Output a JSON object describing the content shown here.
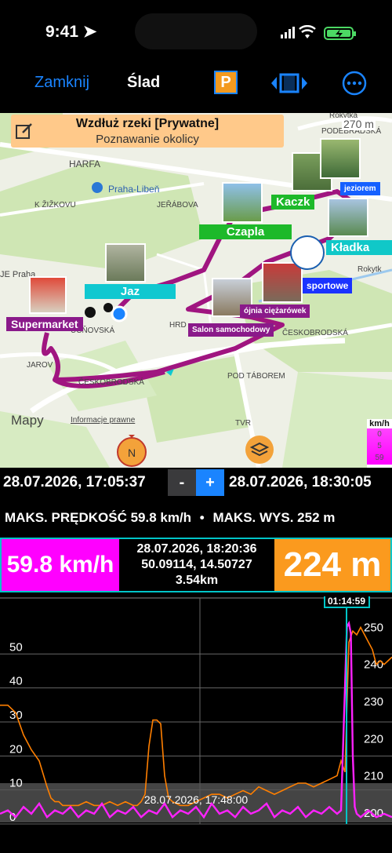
{
  "status_bar": {
    "time": "9:41"
  },
  "nav": {
    "close_label": "Zamknij",
    "title": "Ślad",
    "p_label": "P"
  },
  "map": {
    "card_title": "Wzdłuż rzeki [Prywatne]",
    "card_subtitle": "Poznawanie okolicy",
    "scale_label": "270 m",
    "street_labels": [
      "Rokytka",
      "PODEBRADSKÁ",
      "HARFA",
      "Praha-Libeň",
      "K ŽIŽKOVU",
      "JEŘÁBOVA",
      "JE Praha",
      "UČŇOVSKÁ",
      "HRD",
      "ČESKOBRODSKÁ",
      "JAROV",
      "ČESKOBRODSKÁ",
      "POD TÁBOREM",
      "TVR",
      "Rokytk"
    ],
    "place_tags": [
      {
        "label": "Kaczk",
        "color": "#1db92a"
      },
      {
        "label": "jeziorem",
        "color": "#1560ff"
      },
      {
        "label": "Czapla",
        "color": "#1db92a"
      },
      {
        "label": "Kładka",
        "color": "#10c8c8"
      },
      {
        "label": "sportowe",
        "color": "#1a33ff"
      },
      {
        "label": "Jaz",
        "color": "#10c8d0"
      },
      {
        "label": "ójnia ciężarówek",
        "color": "#8a1a8a"
      },
      {
        "label": "Supermarket",
        "color": "#8a1a8a"
      },
      {
        "label": "Salon samochodowy",
        "color": "#8a1a8a"
      }
    ],
    "attribution_logo": "Mapy",
    "legal": "Informacje prawne",
    "speed_legend_title": "km/h",
    "speed_legend_values": [
      "0",
      "5",
      "59"
    ]
  },
  "time_range": {
    "start": "28.07.2026, 17:05:37",
    "minus": "-",
    "plus": "+",
    "end": "28.07.2026, 18:30:05"
  },
  "max_stats": {
    "speed": "MAKS. PRĘDKOŚĆ 59.8 km/h",
    "sep": "•",
    "altitude": "MAKS. WYS. 252 m"
  },
  "current": {
    "speed": "59.8 km/h",
    "datetime": "28.07.2026, 18:20:36",
    "coords": "50.09114, 14.50727",
    "distance": "3.54km",
    "altitude": "224 m"
  },
  "chart_data": {
    "type": "line",
    "cursor_label": "01:14:59",
    "x_label": "28.07.2026, 17:48:00",
    "left_axis": {
      "ticks": [
        "0",
        "10",
        "20",
        "30",
        "40",
        "50"
      ],
      "range": [
        0,
        60
      ],
      "unit": "km/h"
    },
    "right_axis": {
      "ticks": [
        "200",
        "210",
        "220",
        "230",
        "240",
        "250"
      ],
      "range": [
        197,
        252
      ],
      "unit": "m"
    },
    "series": [
      {
        "color": "#ff7f00",
        "x": [
          0,
          2,
          4,
          6,
          8,
          10,
          12,
          13,
          14,
          15,
          16,
          18,
          20,
          22,
          24,
          26,
          28,
          30,
          32,
          34,
          35,
          36,
          37,
          38,
          39,
          40,
          41,
          42,
          43,
          44,
          46,
          48,
          50,
          52,
          54,
          56,
          58,
          60,
          62,
          64,
          66,
          68,
          70,
          72,
          74,
          76,
          78,
          80,
          82,
          84,
          86,
          87,
          88,
          89,
          90,
          91,
          92,
          93,
          94,
          95,
          96,
          97,
          98,
          99,
          100
        ],
        "y": [
          229,
          229,
          227,
          221,
          217,
          214,
          207,
          204,
          203,
          203,
          202,
          202,
          202,
          203,
          202,
          202,
          203,
          202,
          203,
          202,
          202,
          203,
          205,
          218,
          225,
          225,
          224,
          210,
          204,
          203,
          202,
          202,
          203,
          204,
          205,
          205,
          204,
          205,
          206,
          205,
          207,
          206,
          205,
          206,
          207,
          208,
          208,
          207,
          208,
          209,
          210,
          214,
          211,
          246,
          249,
          248,
          250,
          248,
          246,
          244,
          240,
          241,
          240,
          241,
          242
        ]
      },
      {
        "color": "#ff22ff",
        "x": [
          0,
          2,
          4,
          6,
          8,
          10,
          12,
          14,
          16,
          18,
          20,
          22,
          24,
          26,
          28,
          30,
          32,
          34,
          36,
          38,
          40,
          42,
          44,
          46,
          48,
          50,
          52,
          54,
          56,
          58,
          60,
          62,
          64,
          66,
          68,
          70,
          72,
          74,
          76,
          78,
          80,
          82,
          84,
          86,
          87,
          88,
          88.5,
          89,
          89.5,
          90,
          90.5,
          91,
          92,
          94,
          96,
          98,
          100
        ],
        "y": [
          3,
          4,
          2,
          5,
          3,
          6,
          2,
          4,
          3,
          5,
          2,
          4,
          3,
          6,
          2,
          4,
          3,
          5,
          2,
          4,
          3,
          6,
          2,
          4,
          3,
          5,
          2,
          6,
          3,
          4,
          2,
          5,
          3,
          4,
          6,
          2,
          4,
          3,
          5,
          2,
          4,
          3,
          5,
          3,
          4,
          40,
          58,
          59,
          56,
          20,
          5,
          3,
          2,
          4,
          2,
          3,
          2
        ]
      }
    ]
  }
}
